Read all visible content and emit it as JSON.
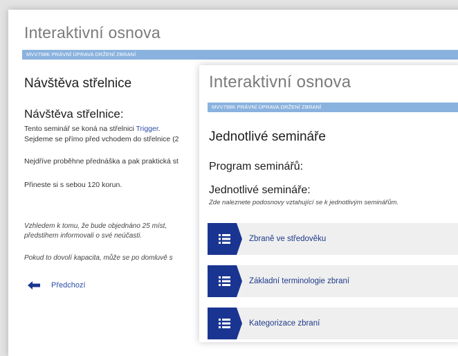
{
  "colors": {
    "accent_bar": "#8ab2de",
    "badge": "#1a3591",
    "link": "#2b4aa8",
    "item_bg": "#efefef"
  },
  "back": {
    "brand": "Interaktivní osnova",
    "course": "MVV798K PRÁVNÍ ÚPRAVA DRŽENÍ ZBRANÍ",
    "title": "Návštěva střelnice",
    "subtitle": "Návštěva střelnice:",
    "line1_prefix": "Tento seminář se koná na střelnici ",
    "line1_link": "Trigger",
    "line1_suffix": ".",
    "line2": "Sejdeme se přímo před vchodem do střelnice (2",
    "line3": "Nejdříve proběhne přednáška a pak praktická st",
    "line4": "Přineste si s sebou 120 korun.",
    "italic1": "Vzhledem k tomu, že bude objednáno 25 míst,",
    "italic2": "předstihem informovali o své neúčasti.",
    "italic3": "Pokud to dovolí kapacita, může se po domluvě s",
    "prev_label": "Předchozí",
    "prev_icon": "arrow-left-icon"
  },
  "front": {
    "brand": "Interaktivní osnova",
    "course": "MVV798K PRÁVNÍ ÚPRAVA DRŽENÍ ZBRANÍ",
    "title": "Jednotlivé semináře",
    "program_heading": "Program seminářů:",
    "section_heading": "Jednotlivé semináře:",
    "section_note": "Zde naleznete podosnovy vztahující se k jednotlivým seminářům.",
    "item_icon": "list-icon",
    "items": [
      {
        "label": "Zbraně ve středověku"
      },
      {
        "label": "Základní terminologie zbraní"
      },
      {
        "label": "Kategorizace zbraní"
      }
    ]
  }
}
